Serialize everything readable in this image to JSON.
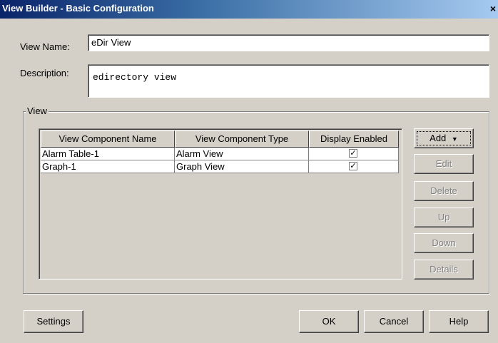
{
  "window": {
    "title": "View Builder - Basic Configuration",
    "close_glyph": "×"
  },
  "form": {
    "view_name_label": "View Name:",
    "view_name_value": "eDir View",
    "description_label": "Description:",
    "description_value": "edirectory view"
  },
  "view_group": {
    "label": "View",
    "table": {
      "columns": [
        "View Component Name",
        "View Component Type",
        "Display Enabled"
      ],
      "rows": [
        {
          "name": "Alarm Table-1",
          "type": "Alarm View",
          "enabled": true,
          "check_glyph": "✓"
        },
        {
          "name": "Graph-1",
          "type": "Graph View",
          "enabled": true,
          "check_glyph": "✓"
        }
      ]
    },
    "buttons": {
      "add": "Add",
      "add_arrow": "▼",
      "edit": "Edit",
      "delete": "Delete",
      "up": "Up",
      "down": "Down",
      "details": "Details"
    }
  },
  "footer": {
    "settings": "Settings",
    "ok": "OK",
    "cancel": "Cancel",
    "help": "Help"
  }
}
